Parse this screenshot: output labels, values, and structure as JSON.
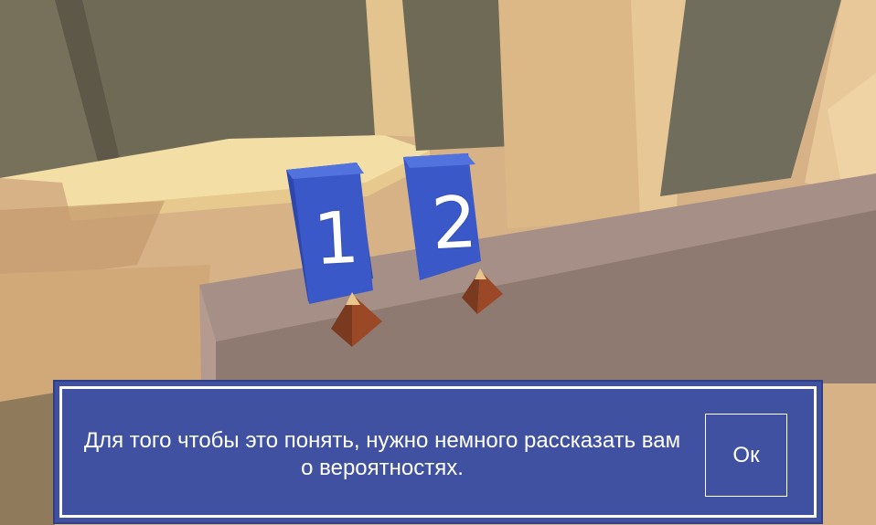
{
  "scene": {
    "blocks": [
      {
        "label": "1",
        "color": "#3a58c8"
      },
      {
        "label": "2",
        "color": "#3a58c8"
      }
    ],
    "colors": {
      "wall": "#d9b58a",
      "window_frame": "#f2dba3",
      "table": "#a48c82",
      "pyramid": "#8a3f22"
    }
  },
  "dialog": {
    "text": "Для того чтобы это понять, нужно немного рассказать вам о вероятностях.",
    "ok_label": "Ок",
    "background": "#3f51a0"
  }
}
